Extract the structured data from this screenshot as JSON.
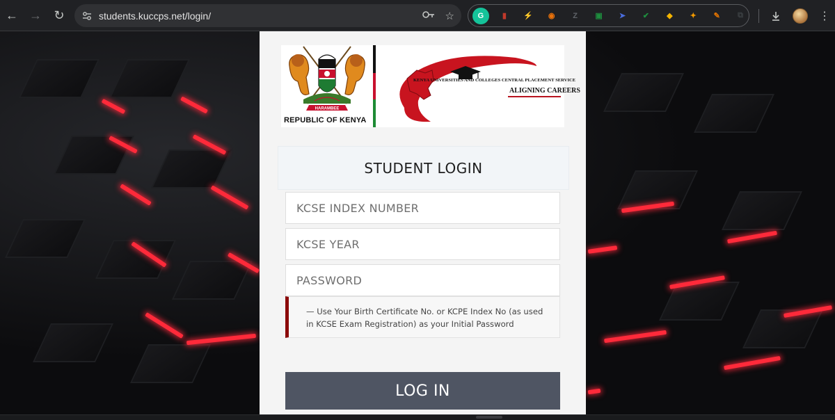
{
  "browser": {
    "url": "students.kuccps.net/login/",
    "nav": {
      "back_icon": "←",
      "forward_icon": "→",
      "reload_icon": "↻"
    },
    "extensions": [
      {
        "name": "grammarly-icon",
        "glyph": "G",
        "color": "#15c39a"
      },
      {
        "name": "chart-extension-icon",
        "glyph": "▮",
        "color": "#c0392b"
      },
      {
        "name": "bolt-extension-icon",
        "glyph": "⚡",
        "color": "#9aa0a6"
      },
      {
        "name": "chrome-color-extension-icon",
        "glyph": "◉",
        "color": "#e8710a"
      },
      {
        "name": "z-extension-icon",
        "glyph": "Z",
        "color": "#5f6368"
      },
      {
        "name": "green-square-extension-icon",
        "glyph": "▣",
        "color": "#1e8e3e"
      },
      {
        "name": "telegram-extension-icon",
        "glyph": "➤",
        "color": "#4a6ee0"
      },
      {
        "name": "checkmark-extension-icon",
        "glyph": "✔",
        "color": "#1e8e3e"
      },
      {
        "name": "drive-extension-icon",
        "glyph": "◆",
        "color": "#f4b400"
      },
      {
        "name": "keyword-extension-icon",
        "glyph": "✦",
        "color": "#f29900"
      },
      {
        "name": "pen-extension-icon",
        "glyph": "✎",
        "color": "#e37400"
      },
      {
        "name": "puzzle-icon",
        "glyph": "⧉",
        "color": "#3c4043"
      }
    ]
  },
  "banner": {
    "coat_caption": "REPUBLIC OF KENYA",
    "motto": "HARAMBEE",
    "kuccps_name": "KENYA UNIVERSITIES AND COLLEGES CENTRAL PLACEMENT SERVICE",
    "kuccps_tagline": "ALIGNING CAREERS"
  },
  "login": {
    "heading": "STUDENT LOGIN",
    "index_placeholder": "KCSE INDEX NUMBER",
    "year_placeholder": "KCSE YEAR",
    "password_placeholder": "PASSWORD",
    "hint": "— Use Your Birth Certificate No. or KCPE Index No (as used in KCSE Exam Registration) as your Initial Password",
    "button_label": "LOG IN"
  },
  "colors": {
    "accent_red": "#8b0a0a",
    "button_bg": "#4f5563",
    "glow_red": "#ff2a3a"
  }
}
